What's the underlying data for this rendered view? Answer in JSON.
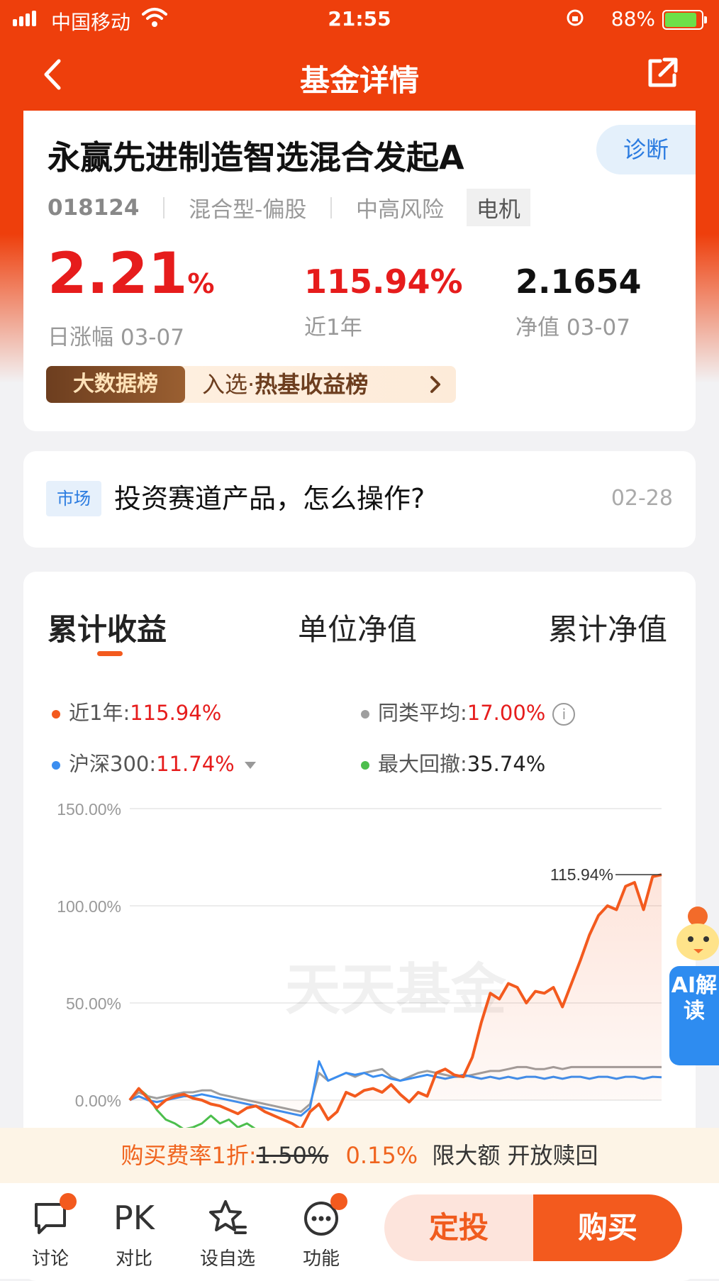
{
  "status_bar": {
    "carrier": "中国移动",
    "time": "21:55",
    "battery": "88%"
  },
  "nav": {
    "title": "基金详情",
    "back_icon": "back-arrow-icon",
    "share_icon": "share-icon"
  },
  "fund": {
    "name": "永赢先进制造智选混合发起A",
    "diagnose_label": "诊断",
    "code": "018124",
    "type": "混合型-偏股",
    "risk": "中高风险",
    "sector_tag": "电机",
    "daily_change_value": "2.21",
    "daily_change_unit": "%",
    "daily_change_label": "日涨幅 03-07",
    "year_return": "115.94%",
    "year_return_label": "近1年",
    "nav_value": "2.1654",
    "nav_label": "净值 03-07",
    "rank_badge": "大数据榜",
    "rank_prefix": "入选·",
    "rank_name": "热基收益榜"
  },
  "market": {
    "tag": "市场",
    "title": "投资赛道产品，怎么操作?",
    "date": "02-28"
  },
  "tabs": [
    "累计收益",
    "单位净值",
    "累计净值"
  ],
  "legend": {
    "fund_label": "近1年:",
    "fund_value": "115.94%",
    "peer_label": "同类平均:",
    "peer_value": "17.00%",
    "index_label": "沪深300:",
    "index_value": "11.74%",
    "drawdown_label": "最大回撤:",
    "drawdown_value": "35.74%"
  },
  "colors": {
    "accent": "#ee3f0c",
    "fund": "#f35a1e",
    "peer": "#9e9e9e",
    "index": "#3b8ef0",
    "drawdown": "#4cbe4c",
    "up": "#e61c1c"
  },
  "chart_data": {
    "type": "line",
    "yticks": [
      "150.00%",
      "100.00%",
      "50.00%",
      "0.00%"
    ],
    "ylim": [
      0,
      150
    ],
    "end_label": "115.94%",
    "watermark": "天天基金",
    "series": [
      {
        "name": "近1年",
        "values": [
          0,
          6,
          1,
          -4,
          0,
          2,
          3,
          1,
          0,
          -2,
          -3,
          -5,
          -7,
          -4,
          -3,
          -6,
          -8,
          -10,
          -12,
          -15,
          -6,
          -2,
          -10,
          -6,
          4,
          2,
          5,
          6,
          4,
          8,
          3,
          -1,
          4,
          2,
          14,
          16,
          13,
          12,
          22,
          40,
          55,
          52,
          60,
          58,
          50,
          56,
          55,
          58,
          48,
          60,
          72,
          85,
          95,
          100,
          98,
          110,
          112,
          98,
          115,
          116
        ]
      },
      {
        "name": "同类平均",
        "values": [
          0,
          4,
          2,
          1,
          2,
          3,
          4,
          4,
          5,
          5,
          3,
          2,
          1,
          0,
          -1,
          -2,
          -3,
          -4,
          -5,
          -6,
          -2,
          14,
          10,
          12,
          14,
          12,
          14,
          15,
          16,
          12,
          10,
          12,
          14,
          15,
          14,
          13,
          12,
          12,
          13,
          14,
          15,
          15,
          16,
          17,
          17,
          16,
          16,
          17,
          16,
          17,
          17,
          17,
          17,
          17,
          17,
          17,
          17,
          17,
          17,
          17
        ]
      },
      {
        "name": "沪深300",
        "values": [
          0,
          2,
          0,
          -1,
          0,
          1,
          2,
          2,
          3,
          2,
          1,
          0,
          -1,
          -2,
          -3,
          -4,
          -5,
          -6,
          -7,
          -8,
          -4,
          20,
          10,
          12,
          14,
          13,
          14,
          12,
          13,
          11,
          10,
          11,
          12,
          13,
          12,
          11,
          12,
          13,
          12,
          11,
          12,
          11,
          12,
          11,
          12,
          12,
          11,
          12,
          11,
          12,
          12,
          11,
          12,
          12,
          11,
          12,
          12,
          11,
          12,
          11.74
        ]
      },
      {
        "name": "最大回撤",
        "values": [
          0,
          6,
          2,
          -5,
          -10,
          -12,
          -15,
          -14,
          -12,
          -8,
          -12,
          -10,
          -14,
          -12,
          -15,
          -16,
          -18,
          -20,
          -22
        ]
      }
    ]
  },
  "fee": {
    "prefix": "购买费率1折:",
    "old": "1.50%",
    "new": "0.15%",
    "suffix": "限大额  开放赎回"
  },
  "bottom": {
    "discuss": "讨论",
    "compare_icon_text": "PK",
    "compare": "对比",
    "watch": "设自选",
    "functions": "功能",
    "auto_invest": "定投",
    "buy": "购买"
  },
  "ai": {
    "label": "AI解读"
  }
}
